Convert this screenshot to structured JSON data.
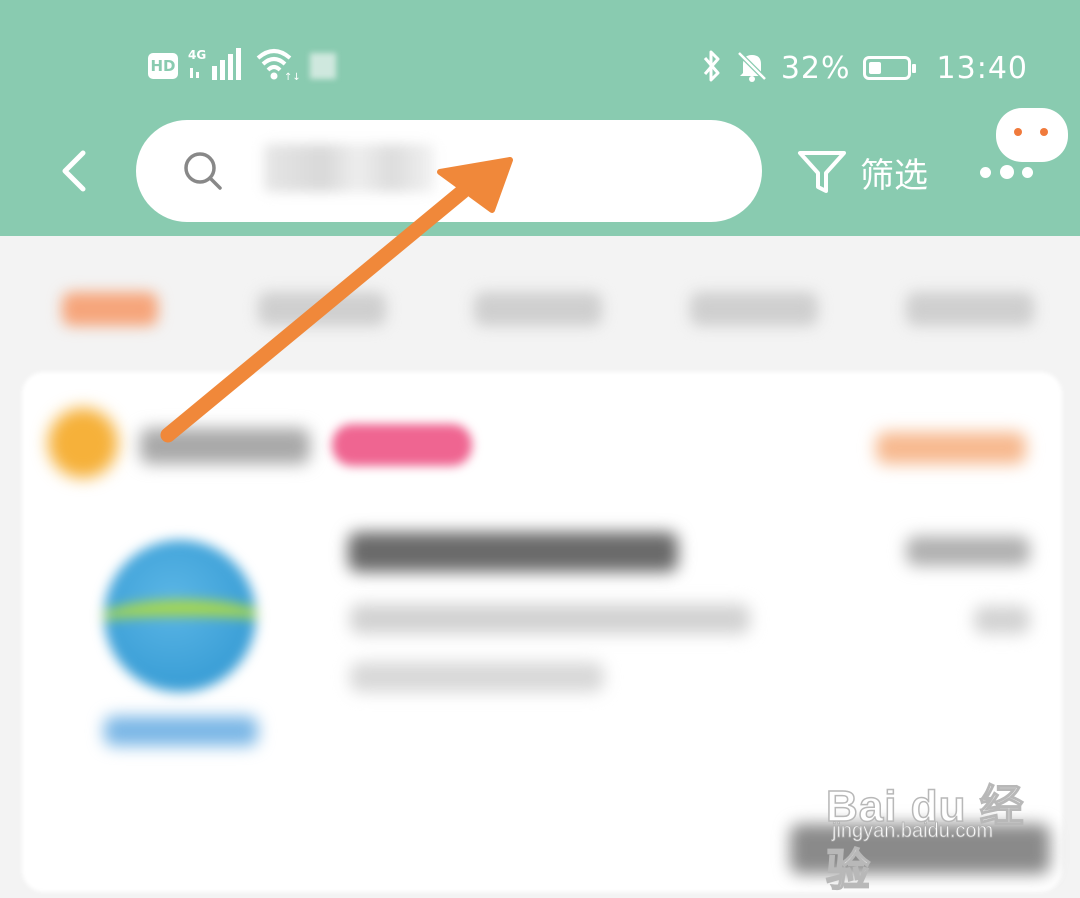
{
  "status_bar": {
    "hd_label": "HD",
    "network": "4G",
    "battery_percent": "32%",
    "battery_level": 0.32,
    "time": "13:40"
  },
  "header": {
    "search_placeholder": "",
    "filter_label": "筛选"
  },
  "watermark": {
    "logo_text": "Bai du 经验",
    "url": "jingyan.baidu.com"
  },
  "colors": {
    "header_bg": "#89cbb0",
    "arrow": "#f0883a",
    "accent": "#f07a3c"
  },
  "icons": [
    "back-icon",
    "search-icon",
    "filter-icon",
    "more-icon",
    "chat-bubble-icon",
    "bluetooth-icon",
    "mute-icon",
    "wifi-icon",
    "signal-icon"
  ]
}
